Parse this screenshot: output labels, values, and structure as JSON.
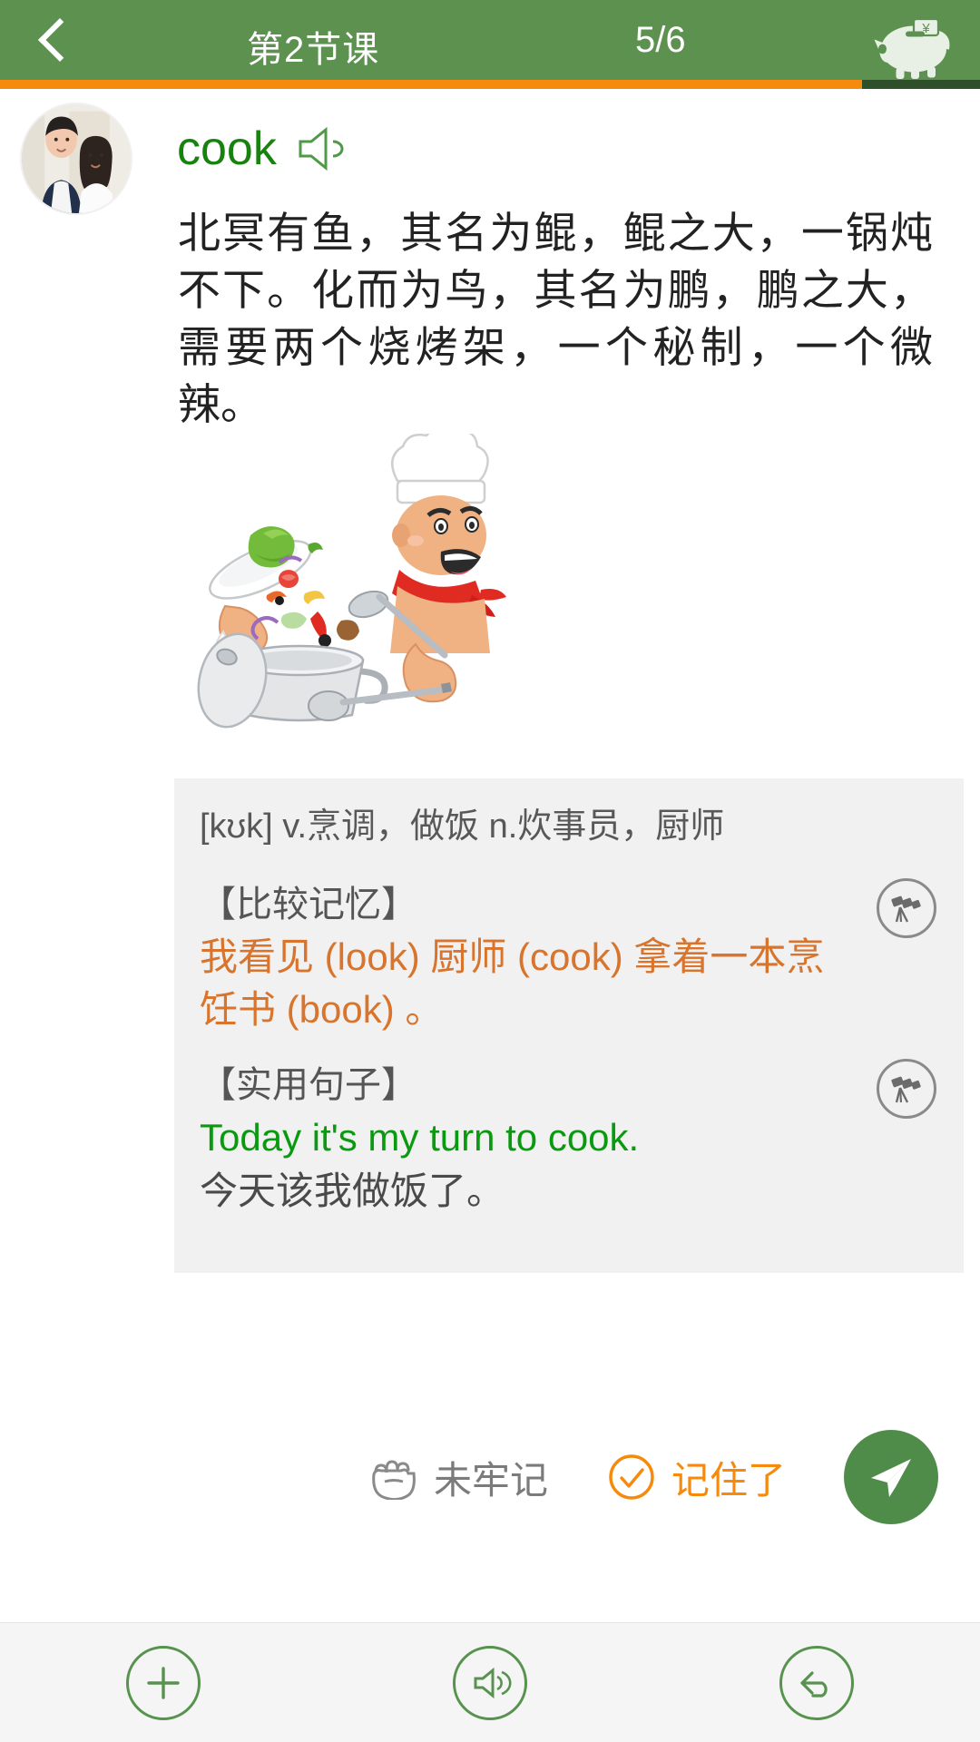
{
  "header": {
    "back_icon": "chevron-left-icon",
    "title": "第2节课",
    "counter": "5/6",
    "piggy_icon": "piggy-bank-icon",
    "progress_percent": 88,
    "bg_color": "#5c9150",
    "progress_color": "#f68a0c",
    "progress_track_color": "#2f4f2b"
  },
  "card": {
    "avatar_name": "user-avatar",
    "word": "cook",
    "word_color": "#18820e",
    "speaker_icon": "speaker-icon",
    "passage": "北冥有鱼，其名为鲲，鲲之大，一锅炖不下。化而为鸟，其名为鹏，鹏之大，需要两个烧烤架，一个秘制，一个微辣。",
    "illustration_name": "chef-cooking-illustration"
  },
  "definition": {
    "phonetic_line": "[kʊk] v.烹调，做饭 n.炊事员，厨师",
    "sections": [
      {
        "title": "【比较记忆】",
        "body": "我看见 (look) 厨师 (cook) 拿着一本烹饪书 (book) 。",
        "body_color": "#d8742b",
        "has_scope": true,
        "scope_icon": "telescope-icon"
      },
      {
        "title": "【实用句子】",
        "body_en": "Today it's my turn to cook.",
        "body_cn": "今天该我做饭了。",
        "body_en_color": "#0a9a10",
        "body_cn_color": "#4a4a4a",
        "has_scope": true,
        "scope_icon": "telescope-icon"
      }
    ]
  },
  "actions": {
    "not_memorized": {
      "icon": "fist-icon",
      "label": "未牢记",
      "color": "#7b7b7b"
    },
    "memorized": {
      "icon": "check-circle-icon",
      "label": "记住了",
      "color": "#f68a0c"
    },
    "send": {
      "icon": "paper-plane-icon",
      "bg_color": "#4f8c4a"
    }
  },
  "bottombar": {
    "items": [
      {
        "icon": "plus-circle-icon",
        "name": "add-button"
      },
      {
        "icon": "speaker-circle-icon",
        "name": "play-audio-button"
      },
      {
        "icon": "undo-circle-icon",
        "name": "undo-button"
      }
    ],
    "icon_color": "#57924e"
  }
}
